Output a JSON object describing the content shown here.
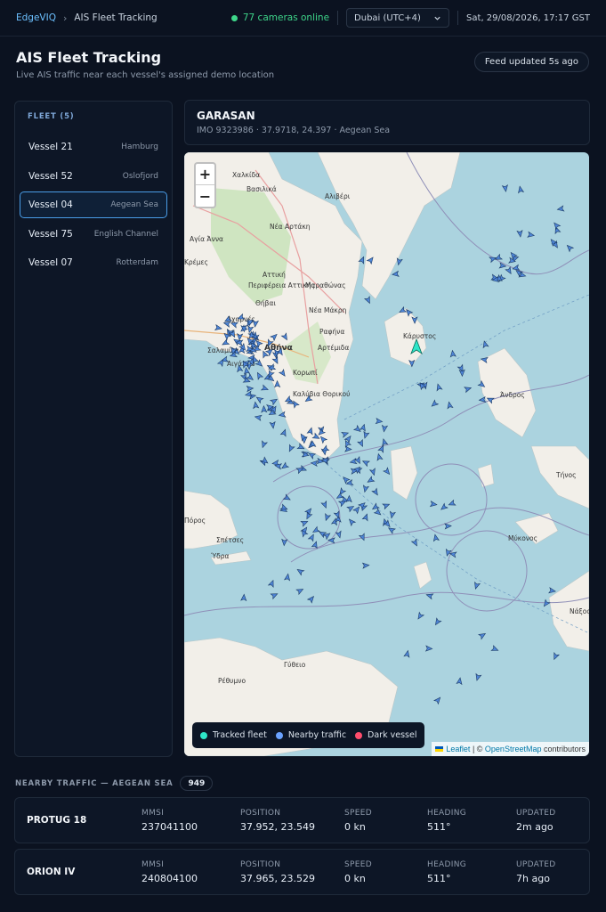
{
  "topbar": {
    "brand": "EdgeVIQ",
    "crumb": "AIS Fleet Tracking",
    "cameras": "77 cameras online",
    "timezone": "Dubai (UTC+4)",
    "clock": "Sat, 29/08/2026, 17:17 GST"
  },
  "page": {
    "title": "AIS Fleet Tracking",
    "subtitle": "Live AIS traffic near each vessel's assigned demo location",
    "feed": "Feed updated 5s ago"
  },
  "fleet": {
    "heading": "FLEET (5)",
    "items": [
      {
        "name": "Vessel 21",
        "location": "Hamburg"
      },
      {
        "name": "Vessel 52",
        "location": "Oslofjord"
      },
      {
        "name": "Vessel 04",
        "location": "Aegean Sea",
        "selected": true
      },
      {
        "name": "Vessel 75",
        "location": "English Channel"
      },
      {
        "name": "Vessel 07",
        "location": "Rotterdam"
      }
    ]
  },
  "vessel": {
    "name": "GARASAN",
    "meta": "IMO 9323986 · 37.9718, 24.397 · Aegean Sea"
  },
  "map": {
    "zoom_in": "+",
    "zoom_out": "−",
    "labels": [
      "Χαλκίδα",
      "Βασιλικά",
      "Αλιβέρι",
      "Νέα Αρτάκη",
      "Αγία Άννα",
      "Κρέμες",
      "Αττική",
      "Περιφέρεια Αττικής",
      "Θήβαι",
      "Μαραθώνας",
      "Νέα Μάκρη",
      "Ραφήνα",
      "Αρτέμιδα",
      "Αθήνα",
      "Αχαρνές",
      "Σαλαμίνα",
      "Αιγάλεω",
      "Κορωπί",
      "Καλύβια Θορικού",
      "Κάρυστος",
      "Άνδρος",
      "Μύκονος",
      "Τήνος",
      "Νάξος",
      "Πόρος",
      "Σπέτσες",
      "Ύδρα",
      "Ρέθυμνο",
      "Γύθειο"
    ],
    "legend": [
      {
        "label": "Tracked fleet",
        "color": "#2ee6c8"
      },
      {
        "label": "Nearby traffic",
        "color": "#6aa2ff"
      },
      {
        "label": "Dark vessel",
        "color": "#ff4d6d"
      }
    ],
    "attribution": {
      "leaflet": "Leaflet",
      "sep": " | © ",
      "osm": "OpenStreetMap",
      "tail": " contributors"
    }
  },
  "nearby": {
    "title": "NEARBY TRAFFIC — AEGEAN SEA",
    "count": "949",
    "columns": {
      "mmsi": "MMSI",
      "position": "POSITION",
      "speed": "SPEED",
      "heading": "HEADING",
      "updated": "UPDATED"
    },
    "rows": [
      {
        "name": "PROTUG 18",
        "mmsi": "237041100",
        "position": "37.952, 23.549",
        "speed": "0 kn",
        "heading": "511°",
        "updated": "2m ago"
      },
      {
        "name": "ORION IV",
        "mmsi": "240804100",
        "position": "37.965, 23.529",
        "speed": "0 kn",
        "heading": "511°",
        "updated": "7h ago"
      }
    ]
  },
  "colors": {
    "accent": "#4a9de8",
    "online": "#3ed68a",
    "sea": "#abd3df",
    "land": "#f2efe9"
  }
}
